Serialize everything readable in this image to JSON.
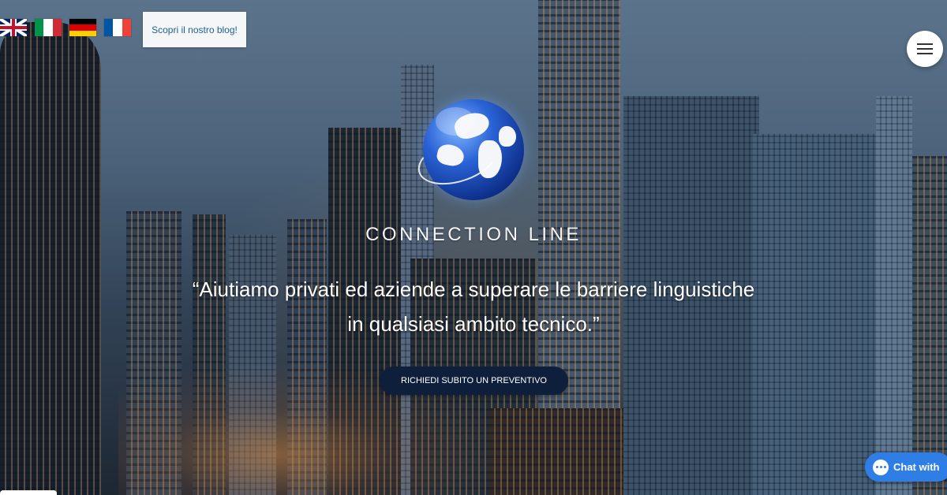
{
  "languages": [
    {
      "name": "English",
      "icon": "uk-flag-icon",
      "colors": [
        "#012169",
        "#ffffff",
        "#c8102e"
      ]
    },
    {
      "name": "Italiano",
      "icon": "italy-flag-icon",
      "colors": [
        "#009246",
        "#ffffff",
        "#ce2b37"
      ]
    },
    {
      "name": "Deutsch",
      "icon": "germany-flag-icon",
      "colors": [
        "#000000",
        "#dd0000",
        "#ffce00"
      ]
    },
    {
      "name": "Français",
      "icon": "france-flag-icon",
      "colors": [
        "#0055a4",
        "#ffffff",
        "#ef4135"
      ]
    }
  ],
  "header": {
    "blog_label": "Scopri il nostro blog!",
    "menu_icon": "hamburger-menu-icon"
  },
  "brand": {
    "name": "CONNECTION LINE",
    "logo_icon": "globe-logo-icon"
  },
  "hero": {
    "quote_line1": "“Aiutiamo privati ed aziende a superare le barriere linguistiche",
    "quote_line2": "in qualsiasi ambito tecnico.”",
    "cta_label": "RICHIEDI SUBITO UN PREVENTIVO",
    "background": "city-skyline-at-dusk"
  },
  "chat_widget": {
    "label": "Chat with",
    "icon": "chat-bubble-icon",
    "color": "#2f7ee6"
  },
  "colors": {
    "cta_bg": "#0e1f3b",
    "blog_text": "#1f5f8f"
  }
}
